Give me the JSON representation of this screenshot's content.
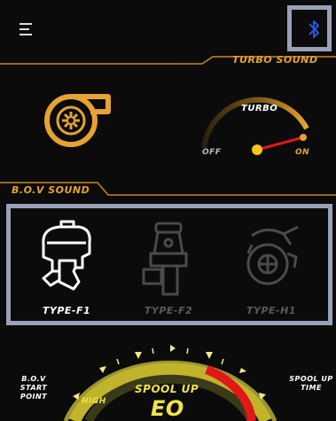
{
  "header": {
    "menu_icon": "menu-icon",
    "bluetooth_icon": "bluetooth-icon",
    "accent": "#e6a233",
    "bluetooth_color": "#2f53e0"
  },
  "turbo": {
    "section_title": "TURBO SOUND",
    "gauge_label": "TURBO",
    "off_label": "OFF",
    "on_label": "ON",
    "state_fraction": 1.0
  },
  "bov": {
    "section_title": "B.O.V SOUND",
    "options": [
      {
        "label": "TYPE-F1",
        "selected": true
      },
      {
        "label": "TYPE-F2",
        "selected": false
      },
      {
        "label": "TYPE-H1",
        "selected": false
      }
    ]
  },
  "spool_gauge": {
    "left_label": "B.O.V START POINT",
    "right_label": "SPOOL UP TIME",
    "center_label": "SPOOL UP",
    "high_label": "HIGH",
    "readout": "ЕО"
  }
}
